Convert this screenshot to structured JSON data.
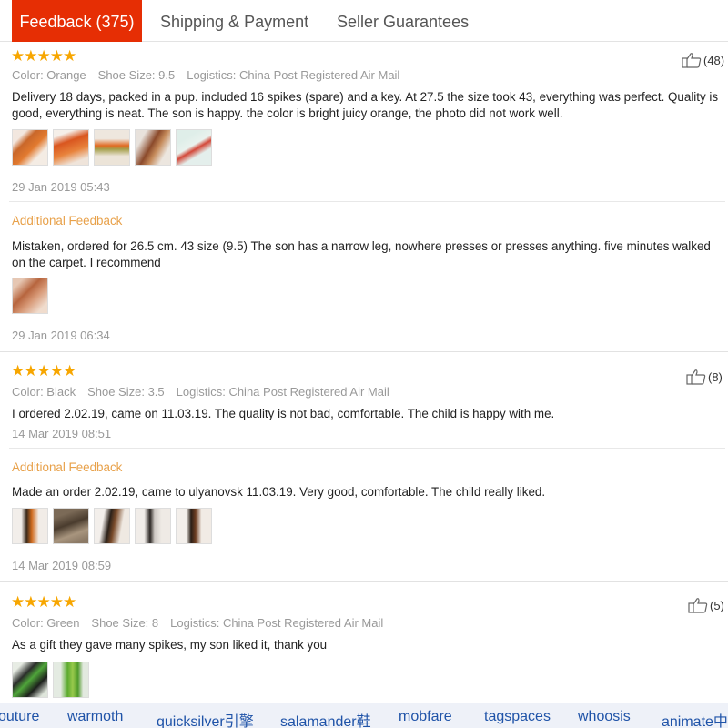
{
  "tabs": [
    {
      "label": "Feedback (375)"
    },
    {
      "label": "Shipping & Payment"
    },
    {
      "label": "Seller Guarantees"
    }
  ],
  "reviews": [
    {
      "rating": 5,
      "color": "Color: Orange",
      "shoe_size": "Shoe Size: 9.5",
      "logistics": "Logistics: China Post Registered Air Mail",
      "helpful": "(48)",
      "text": "Delivery 18 days, packed in a pup. included 16 spikes (spare) and a key. At 27.5 the size took 43, everything was perfect. Quality is good, everything is neat. The son is happy. the color is bright juicy orange, the photo did not work well.",
      "date": "29 Jan 2019 05:43",
      "additional": {
        "label": "Additional Feedback",
        "text": "Mistaken, ordered for 26.5 cm. 43 size (9.5) The son has a narrow leg, nowhere presses or presses anything. five minutes walked on the carpet. I recommend",
        "date": "29 Jan 2019 06:34"
      }
    },
    {
      "rating": 5,
      "color": "Color: Black",
      "shoe_size": "Shoe Size: 3.5",
      "logistics": "Logistics: China Post Registered Air Mail",
      "helpful": "(8)",
      "text": "I ordered 2.02.19, came on 11.03.19. The quality is not bad, comfortable. The child is happy with me.",
      "date": "14 Mar 2019 08:51",
      "additional": {
        "label": "Additional Feedback",
        "text": "Made an order 2.02.19, came to ulyanovsk 11.03.19. Very good, comfortable. The child really liked.",
        "date": "14 Mar 2019 08:59"
      }
    },
    {
      "rating": 5,
      "color": "Color: Green",
      "shoe_size": "Shoe Size: 8",
      "logistics": "Logistics: China Post Registered Air Mail",
      "helpful": "(5)",
      "text": "As a gift they gave many spikes, my son liked it, thank you"
    }
  ],
  "tags": [
    "outure",
    "warmoth",
    "quicksilver引擎",
    "salamander鞋",
    "mobfare",
    "tagspaces",
    "whoosis",
    "animate中"
  ],
  "colors": {
    "accent": "#e62e04",
    "star": "#f7a600",
    "additional": "#e8a14a",
    "tag": "#1f53a8"
  }
}
